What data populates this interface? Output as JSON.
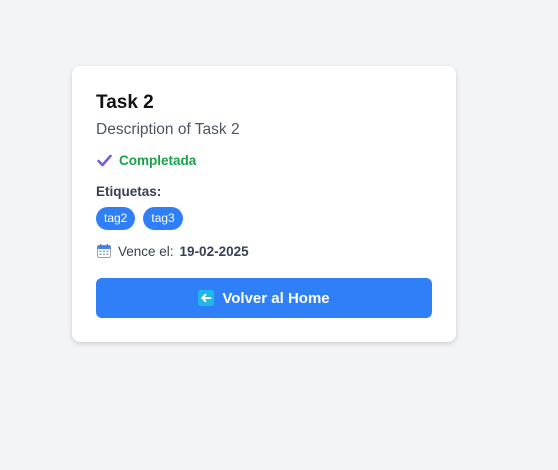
{
  "task": {
    "title": "Task 2",
    "description": "Description of Task 2",
    "status_label": "Completada",
    "tags_label": "Etiquetas:",
    "tags": [
      "tag2",
      "tag3"
    ],
    "due_prefix": "Vence el:",
    "due_date": "19-02-2025"
  },
  "actions": {
    "back_label": "Volver al Home"
  },
  "icons": {
    "status": "check-icon",
    "due": "calendar-icon",
    "back": "back-arrow-icon"
  },
  "colors": {
    "background": "#f3f4f6",
    "card": "#ffffff",
    "accent": "#2f7ff8",
    "success": "#16a34a",
    "check": "#7c5cd6"
  }
}
